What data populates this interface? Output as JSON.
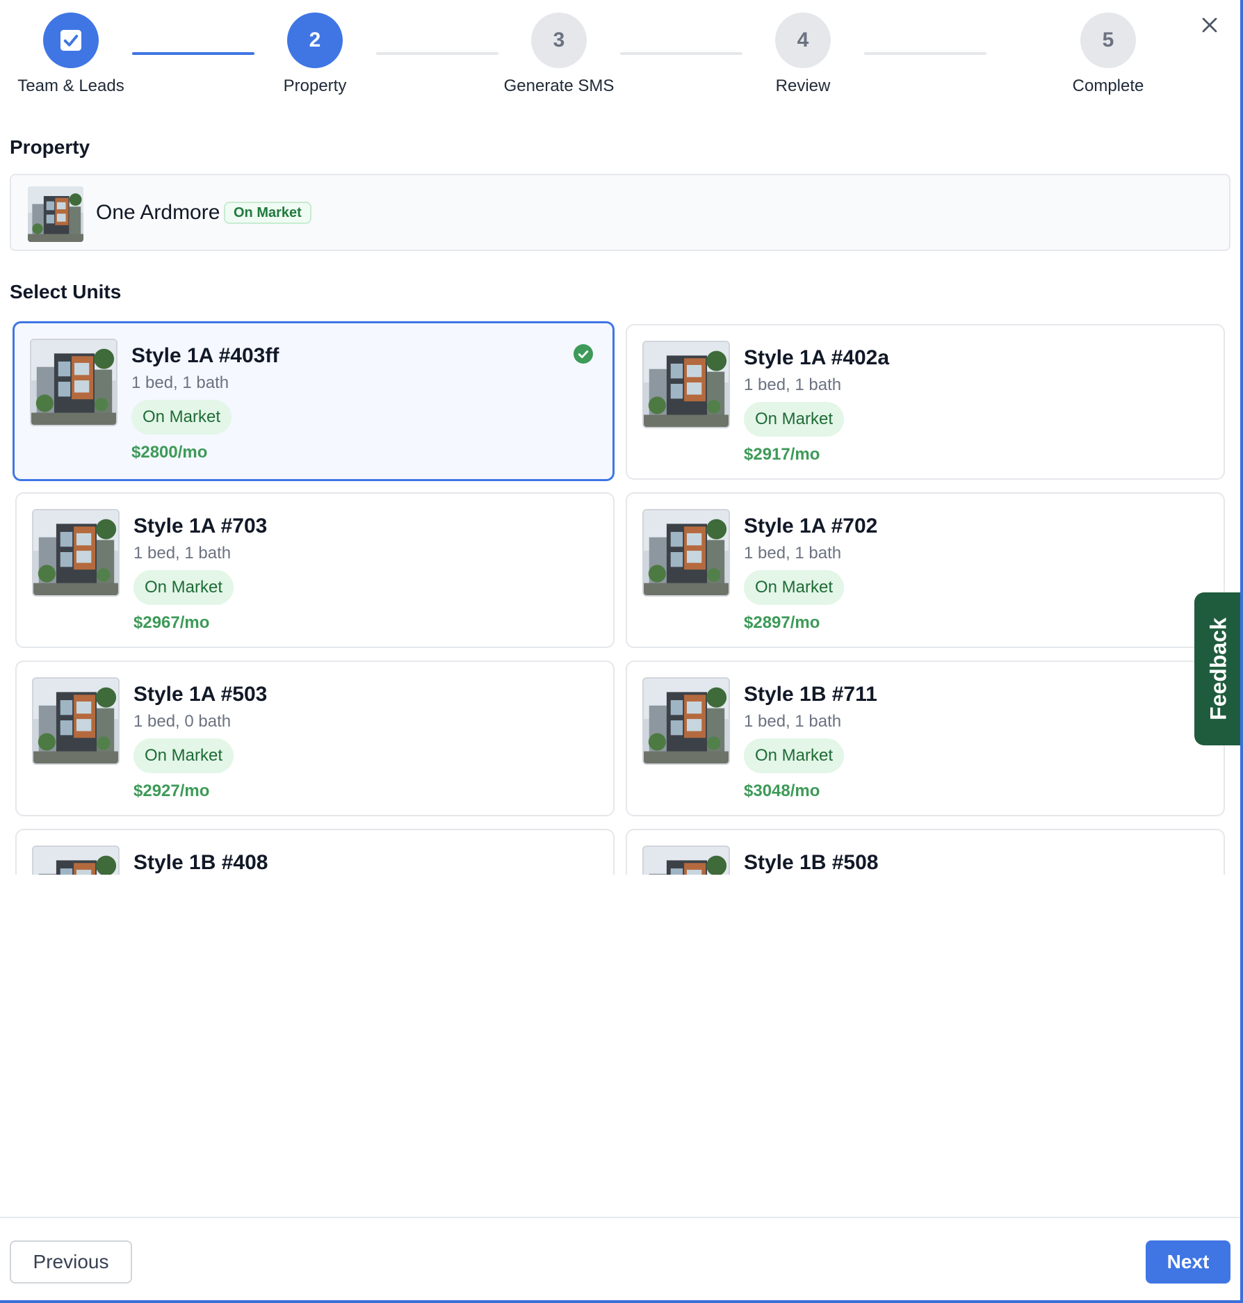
{
  "stepper": {
    "steps": [
      {
        "number": "",
        "label": "Team & Leads",
        "state": "done",
        "icon": "checkbox-check-icon"
      },
      {
        "number": "2",
        "label": "Property",
        "state": "active"
      },
      {
        "number": "3",
        "label": "Generate SMS",
        "state": "todo"
      },
      {
        "number": "4",
        "label": "Review",
        "state": "todo"
      },
      {
        "number": "5",
        "label": "Complete",
        "state": "todo"
      }
    ]
  },
  "close": {
    "icon": "close-icon"
  },
  "property": {
    "heading": "Property",
    "name": "One Ardmore",
    "status": "On Market"
  },
  "units": {
    "heading": "Select Units",
    "items": [
      {
        "title": "Style 1A #403ff",
        "specs": "1 bed, 1 bath",
        "status": "On Market",
        "price": "$2800/mo",
        "selected": true
      },
      {
        "title": "Style 1A #402a",
        "specs": "1 bed, 1 bath",
        "status": "On Market",
        "price": "$2917/mo",
        "selected": false
      },
      {
        "title": "Style 1A #703",
        "specs": "1 bed, 1 bath",
        "status": "On Market",
        "price": "$2967/mo",
        "selected": false
      },
      {
        "title": "Style 1A #702",
        "specs": "1 bed, 1 bath",
        "status": "On Market",
        "price": "$2897/mo",
        "selected": false
      },
      {
        "title": "Style 1A #503",
        "specs": "1 bed, 0 bath",
        "status": "On Market",
        "price": "$2927/mo",
        "selected": false
      },
      {
        "title": "Style 1B #711",
        "specs": "1 bed, 1 bath",
        "status": "On Market",
        "price": "$3048/mo",
        "selected": false
      },
      {
        "title": "Style 1B #408",
        "specs": "",
        "status": "",
        "price": "",
        "selected": false
      },
      {
        "title": "Style 1B #508",
        "specs": "",
        "status": "",
        "price": "",
        "selected": false
      }
    ]
  },
  "feedback": {
    "label": "Feedback"
  },
  "footer": {
    "previous_label": "Previous",
    "next_label": "Next"
  },
  "colors": {
    "primary": "#3f76e4",
    "success": "#3d9a58",
    "badge_bg": "#e3f6e8",
    "feedback_bg": "#1f5c3d"
  }
}
